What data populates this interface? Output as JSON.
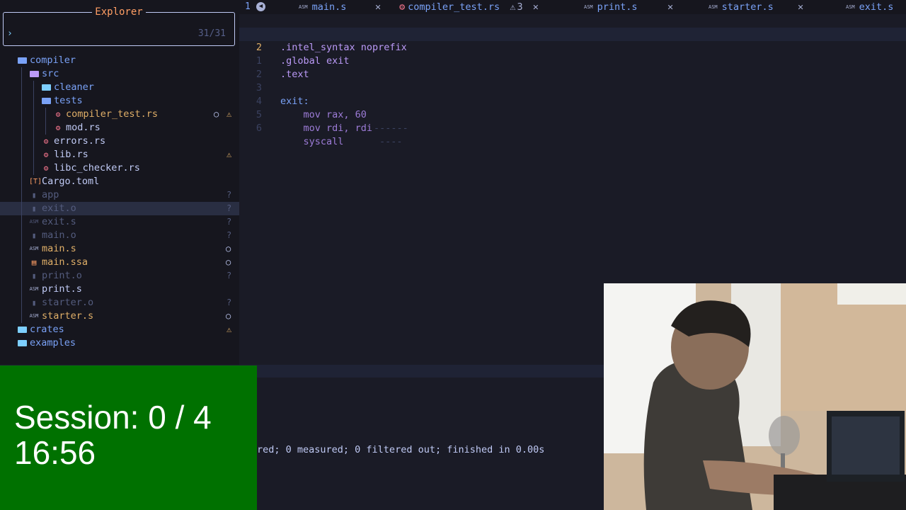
{
  "explorer": {
    "title": "Explorer",
    "prompt": "›",
    "count": "31/31",
    "items": [
      {
        "label": "compiler",
        "type": "folder-open",
        "depth": 0,
        "color": "folder",
        "status": ""
      },
      {
        "label": "src",
        "type": "folder-src",
        "depth": 1,
        "color": "folder",
        "status": ""
      },
      {
        "label": "cleaner",
        "type": "folder",
        "depth": 2,
        "color": "folder",
        "status": ""
      },
      {
        "label": "tests",
        "type": "folder-open",
        "depth": 2,
        "color": "folder",
        "status": ""
      },
      {
        "label": "compiler_test.rs",
        "type": "rust",
        "depth": 3,
        "color": "warn",
        "status": "modified-warning"
      },
      {
        "label": "mod.rs",
        "type": "rust",
        "depth": 3,
        "color": "white",
        "status": ""
      },
      {
        "label": "errors.rs",
        "type": "rust",
        "depth": 2,
        "color": "white",
        "status": ""
      },
      {
        "label": "lib.rs",
        "type": "rust",
        "depth": 2,
        "color": "white",
        "status": "warning"
      },
      {
        "label": "libc_checker.rs",
        "type": "rust",
        "depth": 2,
        "color": "white",
        "status": ""
      },
      {
        "label": "Cargo.toml",
        "type": "toml",
        "depth": 1,
        "color": "white",
        "status": ""
      },
      {
        "label": "app",
        "type": "file",
        "depth": 1,
        "color": "dim",
        "status": "?"
      },
      {
        "label": "exit.o",
        "type": "file",
        "depth": 1,
        "color": "dim",
        "status": "?"
      },
      {
        "label": "exit.s",
        "type": "asm",
        "depth": 1,
        "color": "dim",
        "status": "?"
      },
      {
        "label": "main.o",
        "type": "file",
        "depth": 1,
        "color": "dim",
        "status": "?"
      },
      {
        "label": "main.s",
        "type": "asm",
        "depth": 1,
        "color": "warn",
        "status": "○"
      },
      {
        "label": "main.ssa",
        "type": "ssa",
        "depth": 1,
        "color": "warn",
        "status": "○"
      },
      {
        "label": "print.o",
        "type": "file",
        "depth": 1,
        "color": "dim",
        "status": "?"
      },
      {
        "label": "print.s",
        "type": "asm",
        "depth": 1,
        "color": "white",
        "status": ""
      },
      {
        "label": "starter.o",
        "type": "file",
        "depth": 1,
        "color": "dim",
        "status": "?"
      },
      {
        "label": "starter.s",
        "type": "asm",
        "depth": 1,
        "color": "warn",
        "status": "○"
      },
      {
        "label": "crates",
        "type": "folder",
        "depth": 0,
        "color": "folder",
        "status": "warning"
      },
      {
        "label": "examples",
        "type": "folder",
        "depth": 0,
        "color": "folder",
        "status": ""
      }
    ],
    "selected_index": 11
  },
  "tabs": {
    "number": "1",
    "items": [
      {
        "label": "main.s",
        "icon": "ASM",
        "badge": "",
        "close": "✕"
      },
      {
        "label": "compiler_test.rs",
        "icon": "rust",
        "badge": "3",
        "close": "✕"
      },
      {
        "label": "print.s",
        "icon": "ASM",
        "badge": "",
        "close": "✕"
      },
      {
        "label": "starter.s",
        "icon": "ASM",
        "badge": "",
        "close": "✕"
      },
      {
        "label": "exit.s",
        "icon": "ASM",
        "badge": "",
        "close": ""
      }
    ]
  },
  "editor": {
    "current_line": 2,
    "lines": [
      {
        "num": "1",
        "code": ".intel_syntax noprefix"
      },
      {
        "num": "2",
        "code": ".global exit"
      },
      {
        "num": "1",
        "code": ".text"
      },
      {
        "num": "2",
        "code": ""
      },
      {
        "num": "3",
        "code": "exit:"
      },
      {
        "num": "4",
        "code": "    mov rax, 60"
      },
      {
        "num": "5",
        "code": "    mov rdi, rdi"
      },
      {
        "num": "6",
        "code": "    syscall"
      }
    ]
  },
  "terminal": {
    "line": "red; 0 measured; 0 filtered out; finished in 0.00s"
  },
  "overlay": {
    "session": "Session: 0 / 4",
    "time": "16:56"
  },
  "colors": {
    "background": "#1a1b26",
    "sidebar": "#16161e",
    "accent": "#7aa2f7",
    "warning": "#e0af68",
    "overlay_green": "#007100"
  }
}
